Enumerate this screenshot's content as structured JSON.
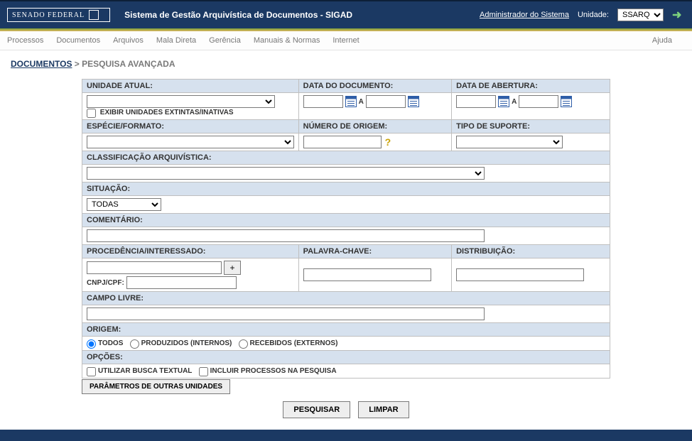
{
  "header": {
    "logo_text": "SENADO FEDERAL",
    "title": "Sistema de Gestão Arquivística de Documentos - SIGAD",
    "admin_link": "Administrador do Sistema",
    "unidade_label": "Unidade:",
    "unidade_value": "SSARQ"
  },
  "menu": {
    "processos": "Processos",
    "documentos": "Documentos",
    "arquivos": "Arquivos",
    "mala_direta": "Mala Direta",
    "gerencia": "Gerência",
    "manuais_normas": "Manuais & Normas",
    "internet": "Internet",
    "ajuda": "Ajuda"
  },
  "breadcrumb": {
    "link": "DOCUMENTOS",
    "sep": " > ",
    "current": "PESQUISA AVANÇADA"
  },
  "labels": {
    "unidade_atual": "UNIDADE ATUAL:",
    "exibir_extintas": "EXIBIR UNIDADES EXTINTAS/INATIVAS",
    "data_documento": "DATA DO DOCUMENTO:",
    "data_abertura": "DATA DE ABERTURA:",
    "date_a": "A",
    "especie_formato": "ESPÉCIE/FORMATO:",
    "numero_origem": "NÚMERO DE ORIGEM:",
    "tipo_suporte": "TIPO DE SUPORTE:",
    "classificacao": "CLASSIFICAÇÃO ARQUIVÍSTICA:",
    "situacao": "SITUAÇÃO:",
    "situacao_value": "TODAS",
    "comentario": "COMENTÁRIO:",
    "procedencia": "PROCEDÊNCIA/INTERESSADO:",
    "cnpj_cpf": "CNPJ/CPF:",
    "plus": "+",
    "palavra_chave": "PALAVRA-CHAVE:",
    "distribuicao": "DISTRIBUIÇÃO:",
    "campo_livre": "CAMPO LIVRE:",
    "origem": "ORIGEM:",
    "origem_todos": "TODOS",
    "origem_produzidos": "PRODUZIDOS (INTERNOS)",
    "origem_recebidos": "RECEBIDOS (EXTERNOS)",
    "opcoes": "OPÇÕES:",
    "busca_textual": "UTILIZAR BUSCA TEXTUAL",
    "incluir_processos": "INCLUIR PROCESSOS NA PESQUISA",
    "param_outras": "PARÂMETROS DE OUTRAS UNIDADES"
  },
  "actions": {
    "pesquisar": "PESQUISAR",
    "limpar": "LIMPAR"
  }
}
